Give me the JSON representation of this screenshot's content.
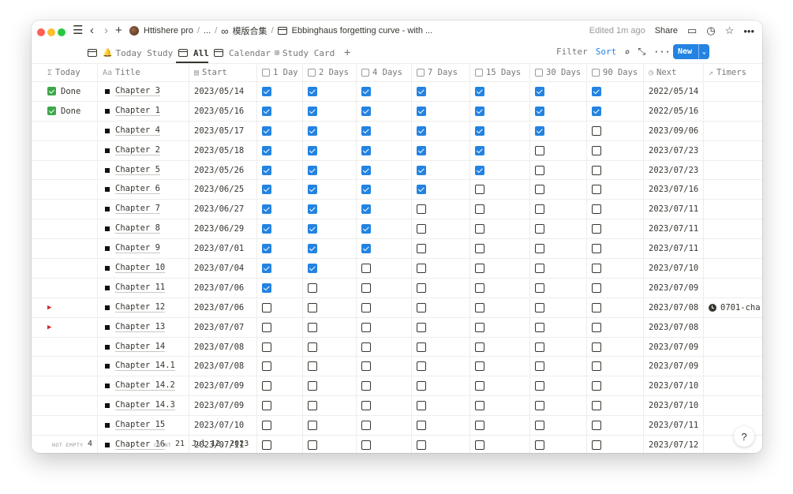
{
  "breadcrumb": {
    "workspace": "Httishere pro",
    "ellipsis": "...",
    "template": "模版合集",
    "page": "Ebbinghaus forgetting curve - with ..."
  },
  "topbar": {
    "edited": "Edited 1m ago",
    "share": "Share"
  },
  "views": {
    "tabs": [
      {
        "label": "Today Study"
      },
      {
        "label": "All"
      },
      {
        "label": "Calendar"
      },
      {
        "label": "Study Card"
      }
    ],
    "add": "+",
    "filter": "Filter",
    "sort": "Sort",
    "new": "New"
  },
  "columns": {
    "today": "Today",
    "title": "Title",
    "start": "Start",
    "d1": "1 Day",
    "d2": "2 Days",
    "d4": "4 Days",
    "d7": "7 Days",
    "d15": "15 Days",
    "d30": "30 Days",
    "d90": "90 Days",
    "next": "Next",
    "timers": "Timers"
  },
  "rows": [
    {
      "today": "done",
      "today_text": "Done",
      "title": "Chapter 3",
      "start": "2023/05/14",
      "checks": [
        1,
        1,
        1,
        1,
        1,
        1,
        1
      ],
      "next": "2022/05/14",
      "timer": ""
    },
    {
      "today": "done",
      "today_text": "Done",
      "title": "Chapter 1",
      "start": "2023/05/16",
      "checks": [
        1,
        1,
        1,
        1,
        1,
        1,
        1
      ],
      "next": "2022/05/16",
      "timer": ""
    },
    {
      "today": "",
      "today_text": "",
      "title": "Chapter 4",
      "start": "2023/05/17",
      "checks": [
        1,
        1,
        1,
        1,
        1,
        1,
        0
      ],
      "next": "2023/09/06",
      "timer": ""
    },
    {
      "today": "",
      "today_text": "",
      "title": "Chapter 2",
      "start": "2023/05/18",
      "checks": [
        1,
        1,
        1,
        1,
        1,
        0,
        0
      ],
      "next": "2023/07/23",
      "timer": ""
    },
    {
      "today": "",
      "today_text": "",
      "title": "Chapter 5",
      "start": "2023/05/26",
      "checks": [
        1,
        1,
        1,
        1,
        1,
        0,
        0
      ],
      "next": "2023/07/23",
      "timer": ""
    },
    {
      "today": "",
      "today_text": "",
      "title": "Chapter 6",
      "start": "2023/06/25",
      "checks": [
        1,
        1,
        1,
        1,
        0,
        0,
        0
      ],
      "next": "2023/07/16",
      "timer": ""
    },
    {
      "today": "",
      "today_text": "",
      "title": "Chapter 7",
      "start": "2023/06/27",
      "checks": [
        1,
        1,
        1,
        0,
        0,
        0,
        0
      ],
      "next": "2023/07/11",
      "timer": ""
    },
    {
      "today": "",
      "today_text": "",
      "title": "Chapter 8",
      "start": "2023/06/29",
      "checks": [
        1,
        1,
        1,
        0,
        0,
        0,
        0
      ],
      "next": "2023/07/11",
      "timer": ""
    },
    {
      "today": "",
      "today_text": "",
      "title": "Chapter 9",
      "start": "2023/07/01",
      "checks": [
        1,
        1,
        1,
        0,
        0,
        0,
        0
      ],
      "next": "2023/07/11",
      "timer": ""
    },
    {
      "today": "",
      "today_text": "",
      "title": "Chapter 10",
      "start": "2023/07/04",
      "checks": [
        1,
        1,
        0,
        0,
        0,
        0,
        0
      ],
      "next": "2023/07/10",
      "timer": ""
    },
    {
      "today": "",
      "today_text": "",
      "title": "Chapter 11",
      "start": "2023/07/06",
      "checks": [
        1,
        0,
        0,
        0,
        0,
        0,
        0
      ],
      "next": "2023/07/09",
      "timer": ""
    },
    {
      "today": "flag",
      "today_text": "",
      "title": "Chapter 12",
      "start": "2023/07/06",
      "checks": [
        0,
        0,
        0,
        0,
        0,
        0,
        0
      ],
      "next": "2023/07/08",
      "timer": "0701-cha"
    },
    {
      "today": "flag",
      "today_text": "",
      "title": "Chapter 13",
      "start": "2023/07/07",
      "checks": [
        0,
        0,
        0,
        0,
        0,
        0,
        0
      ],
      "next": "2023/07/08",
      "timer": ""
    },
    {
      "today": "",
      "today_text": "",
      "title": "Chapter 14",
      "start": "2023/07/08",
      "checks": [
        0,
        0,
        0,
        0,
        0,
        0,
        0
      ],
      "next": "2023/07/09",
      "timer": ""
    },
    {
      "today": "",
      "today_text": "",
      "title": "Chapter 14.1",
      "start": "2023/07/08",
      "checks": [
        0,
        0,
        0,
        0,
        0,
        0,
        0
      ],
      "next": "2023/07/09",
      "timer": ""
    },
    {
      "today": "",
      "today_text": "",
      "title": "Chapter 14.2",
      "start": "2023/07/09",
      "checks": [
        0,
        0,
        0,
        0,
        0,
        0,
        0
      ],
      "next": "2023/07/10",
      "timer": ""
    },
    {
      "today": "",
      "today_text": "",
      "title": "Chapter 14.3",
      "start": "2023/07/09",
      "checks": [
        0,
        0,
        0,
        0,
        0,
        0,
        0
      ],
      "next": "2023/07/10",
      "timer": ""
    },
    {
      "today": "",
      "today_text": "",
      "title": "Chapter 15",
      "start": "2023/07/10",
      "checks": [
        0,
        0,
        0,
        0,
        0,
        0,
        0
      ],
      "next": "2023/07/11",
      "timer": ""
    },
    {
      "today": "",
      "today_text": "",
      "title": "Chapter 16",
      "start": "2023/07/11",
      "checks": [
        0,
        0,
        0,
        0,
        0,
        0,
        0
      ],
      "next": "2023/07/12",
      "timer": ""
    }
  ],
  "footer": {
    "not_empty_label": "NOT EMPTY",
    "not_empty_value": "4",
    "count_label": "COUNT",
    "count_value": "21",
    "date": "Jul 12, 2023"
  },
  "help": "?",
  "colors": {
    "accent": "#2383e2",
    "done": "#3ea74a",
    "flag": "#d0262a"
  }
}
